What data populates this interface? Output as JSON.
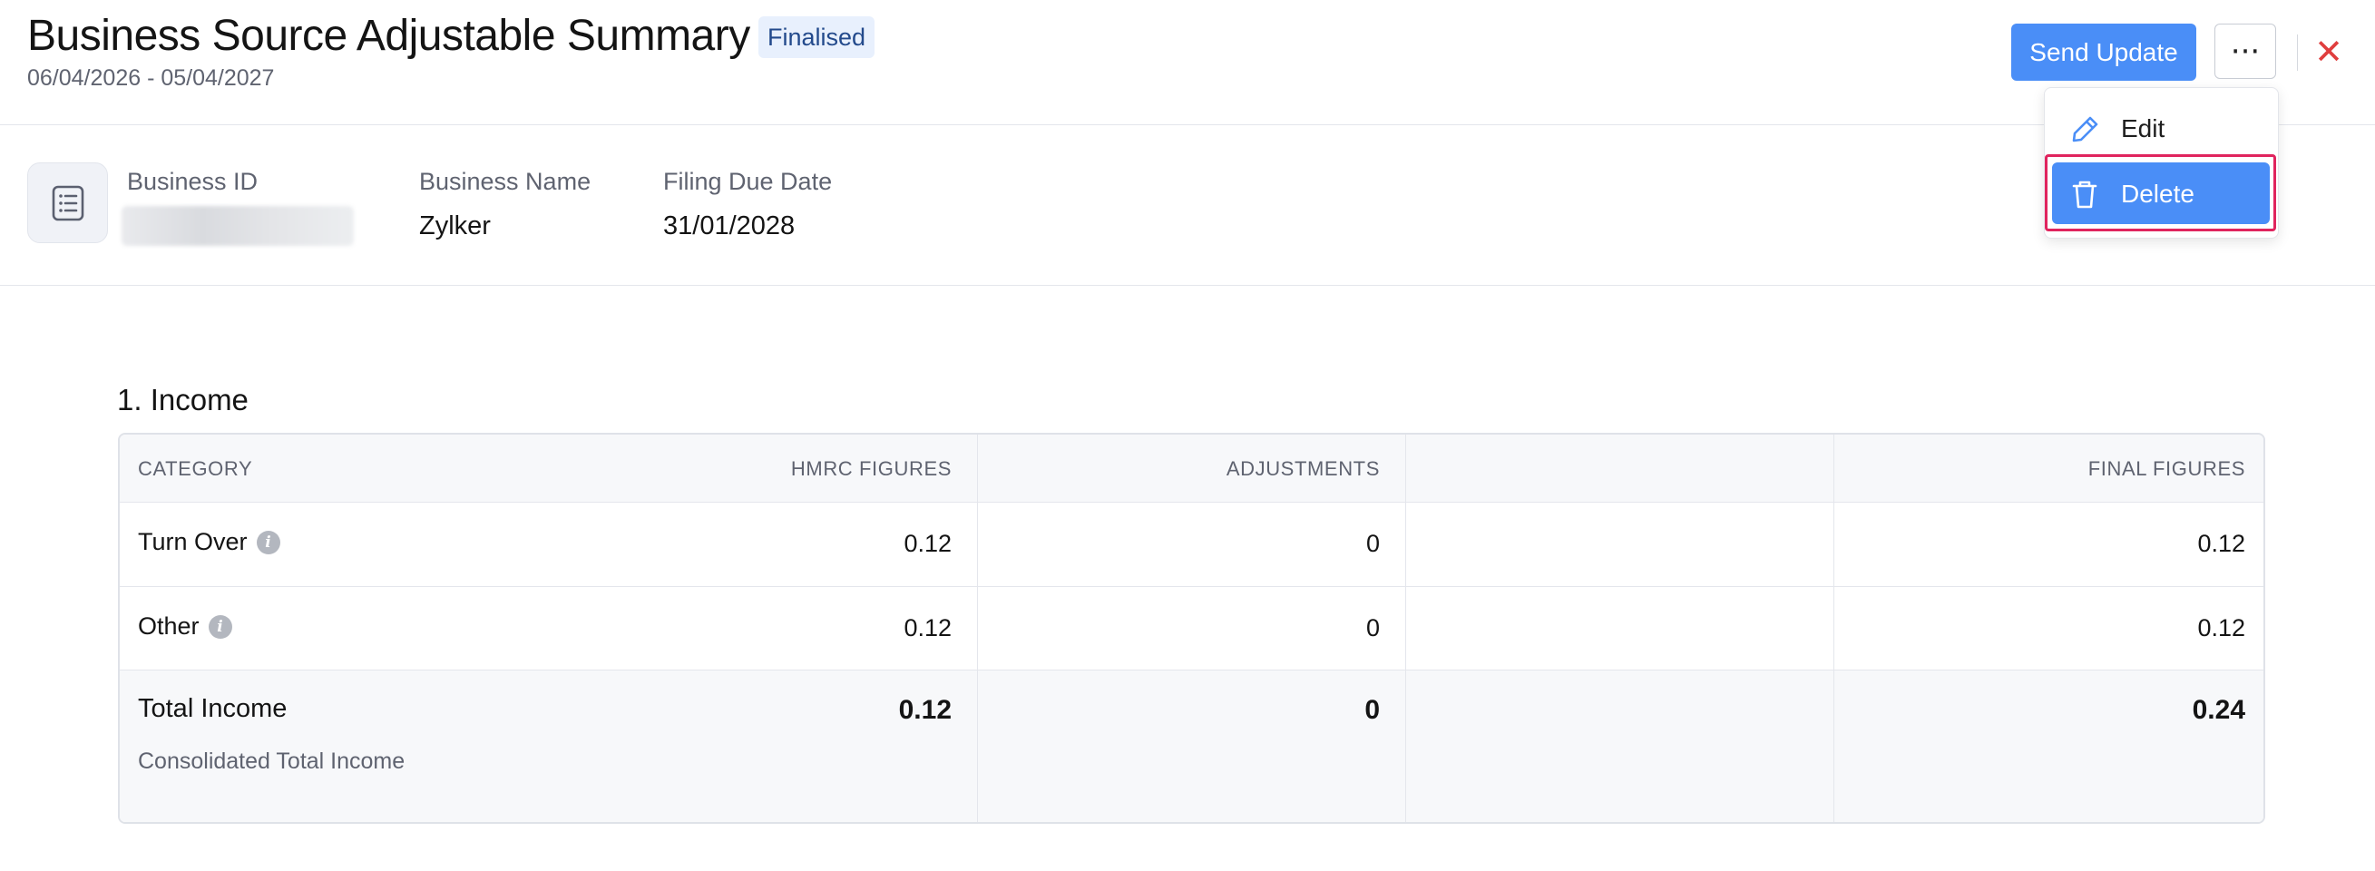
{
  "header": {
    "title": "Business Source Adjustable Summary",
    "status_badge": "Finalised",
    "date_range": "06/04/2026 - 05/04/2027",
    "send_update_label": "Send Update",
    "more_icon": "ellipsis-icon",
    "more_glyph": "···",
    "close_icon": "close-icon",
    "close_glyph": "✕"
  },
  "info": {
    "icon": "document-list-icon",
    "fields": [
      {
        "label": "Business ID",
        "value": ""
      },
      {
        "label": "Business Name",
        "value": "Zylker"
      },
      {
        "label": "Filing Due Date",
        "value": "31/01/2028"
      }
    ]
  },
  "dropdown": {
    "items": [
      {
        "label": "Edit",
        "icon": "pencil-icon"
      },
      {
        "label": "Delete",
        "icon": "trash-icon"
      }
    ]
  },
  "section": {
    "title": "1. Income",
    "columns": [
      "CATEGORY",
      "HMRC FIGURES",
      "ADJUSTMENTS",
      "FINAL FIGURES"
    ],
    "rows": [
      {
        "category": "Turn Over",
        "hmrc": "0.12",
        "adjustments": "0",
        "final": "0.12"
      },
      {
        "category": "Other",
        "hmrc": "0.12",
        "adjustments": "0",
        "final": "0.12"
      }
    ],
    "total": {
      "label": "Total Income",
      "sub_label": "Consolidated Total Income",
      "hmrc": "0.12",
      "adjustments": "0",
      "final": "0.24"
    },
    "info_glyph": "i"
  },
  "colors": {
    "primary": "#4a8ef7",
    "badge_bg": "#e8f0fd",
    "close": "#e03e3e",
    "highlight": "#e0245e"
  }
}
